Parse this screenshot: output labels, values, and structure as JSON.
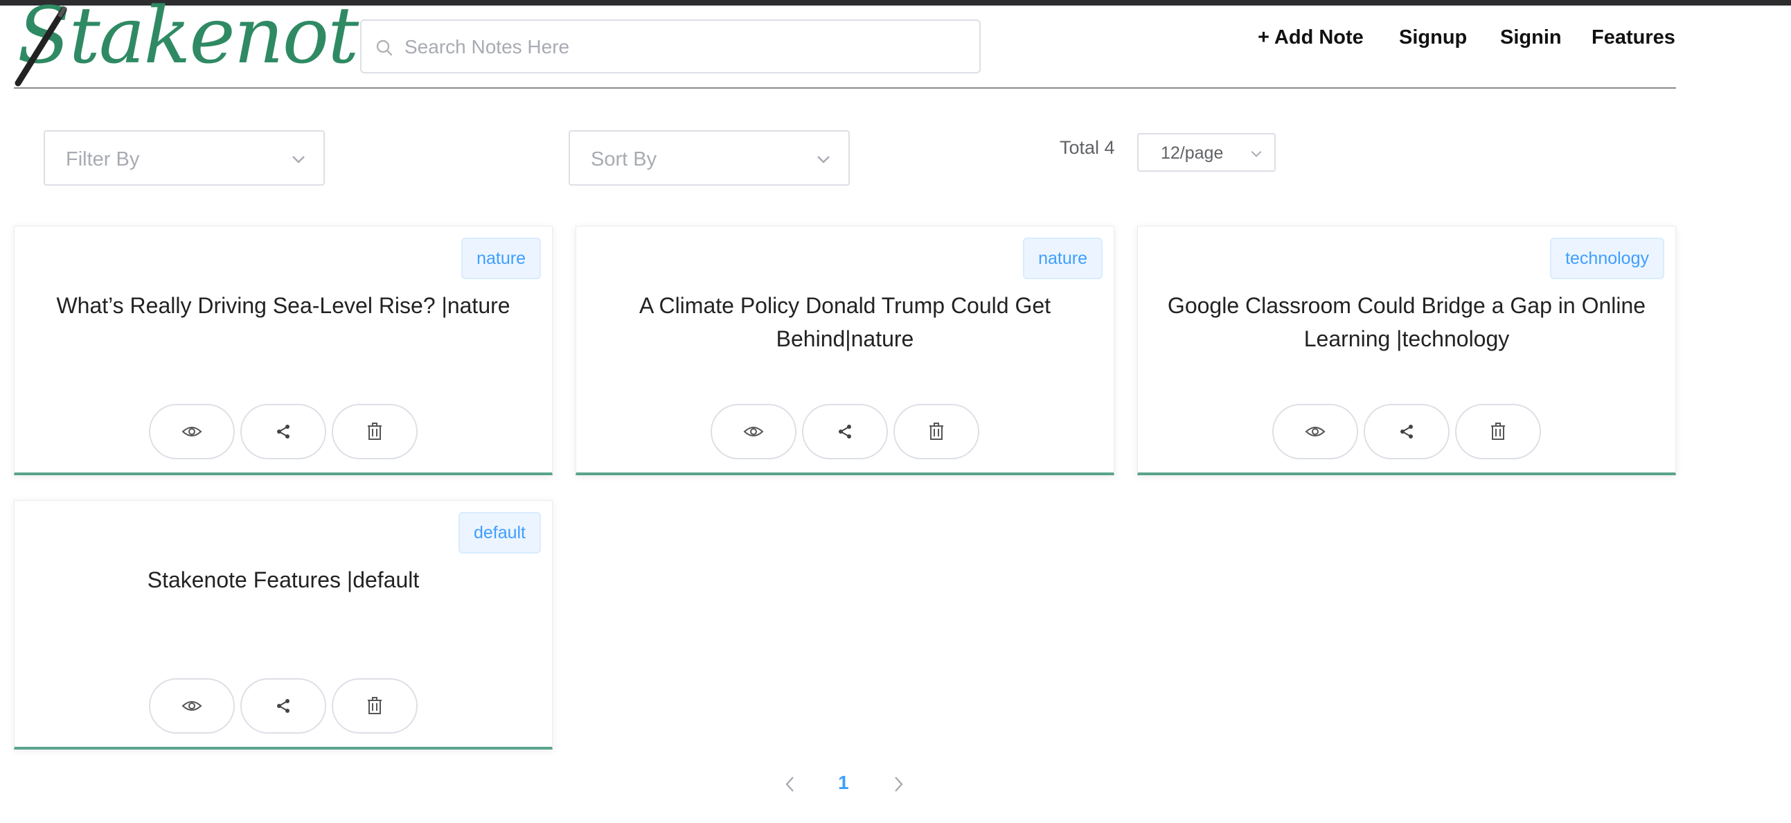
{
  "header": {
    "logo_text": "Stakenote",
    "search_placeholder": "Search Notes Here",
    "nav": {
      "add_note": "+ Add Note",
      "signup": "Signup",
      "signin": "Signin",
      "features": "Features"
    }
  },
  "controls": {
    "filter_placeholder": "Filter By",
    "sort_placeholder": "Sort By",
    "total": "Total 4",
    "page_size": "12/page"
  },
  "colors": {
    "accent": "#5aa48e",
    "logo": "#2f8a64",
    "tag_text": "#409eff",
    "tag_bg": "#ecf5ff"
  },
  "notes": [
    {
      "tag": "nature",
      "title": "What’s Really Driving Sea-Level Rise? |nature"
    },
    {
      "tag": "nature",
      "title": "A Climate Policy Donald Trump Could Get Behind|nature"
    },
    {
      "tag": "technology",
      "title": "Google Classroom Could Bridge a Gap in Online Learning |technology"
    },
    {
      "tag": "default",
      "title": "Stakenote Features |default"
    }
  ],
  "note_actions": [
    "eye-icon",
    "share-icon",
    "trash-icon"
  ],
  "pagination": {
    "current_page": "1"
  }
}
